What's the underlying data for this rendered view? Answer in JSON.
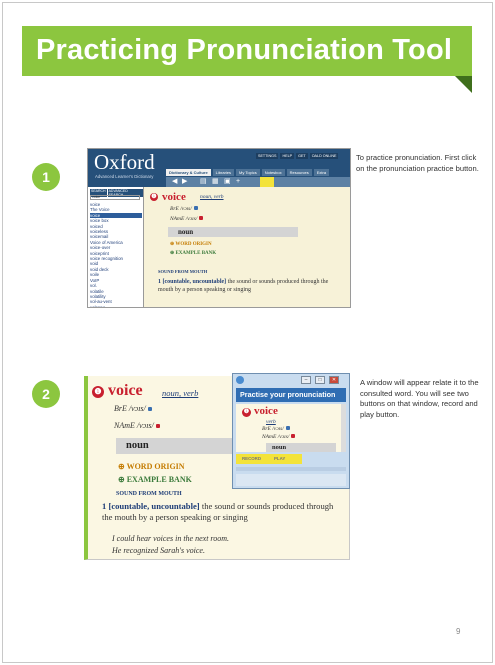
{
  "title": "Practicing Pronunciation Tool",
  "steps": [
    {
      "number": "1",
      "text": "To practice pronunciation. First click on the pronunciation practice button."
    },
    {
      "number": "2",
      "text": "A window will appear relate it to the consulted word. You will see two buttons on that window, record and play button."
    }
  ],
  "shot1": {
    "logo": "Oxford",
    "subtitle": "Advanced Learner's Dictionary",
    "menu": [
      "SETTINGS",
      "HELP",
      "GET",
      "OALD ONLINE"
    ],
    "tabs": [
      "Dictionary & Culture",
      "Libraries",
      "My Topics",
      "Notesbox",
      "Resources",
      "Extra"
    ],
    "search_tabs": [
      "SEARCH",
      "ADVANCED SEARCH"
    ],
    "search_value": "voice",
    "word_list": [
      "voice",
      "The Voice",
      "voice",
      "voice box",
      "voiced",
      "voiceless",
      "voicemail",
      "Voice of America",
      "voice-over",
      "voiceprint",
      "voice recognition",
      "void",
      "void deck",
      "voile",
      "VoIP",
      "vol.",
      "volatile",
      "volatility",
      "vol-au-vent",
      "volcano"
    ],
    "selected_index": 2
  },
  "entry": {
    "headword": "voice",
    "pos": "noun, verb",
    "bre": "BrE /vɔɪs/",
    "name": "NAmE /vɔɪs/",
    "noun": "noun",
    "word_origin": "WORD ORIGIN",
    "example_bank": "EXAMPLE BANK",
    "sense_heading": "SOUND FROM MOUTH",
    "sense_number": "1",
    "grammar": "[countable, uncountable]",
    "definition": "the sound or sounds produced through the mouth by a person speaking or singing",
    "examples": [
      "I could hear voices in the next room.",
      "He recognized Sarah's voice."
    ]
  },
  "popup": {
    "title": "Practise your pronunciation",
    "headword": "voice",
    "pos": "verb",
    "bre": "BrE /vɔɪs/",
    "name": "NAmE /vɔɪs/",
    "noun": "noun",
    "record_label": "RECORD",
    "play_label": "PLAY"
  },
  "page_number": "9"
}
